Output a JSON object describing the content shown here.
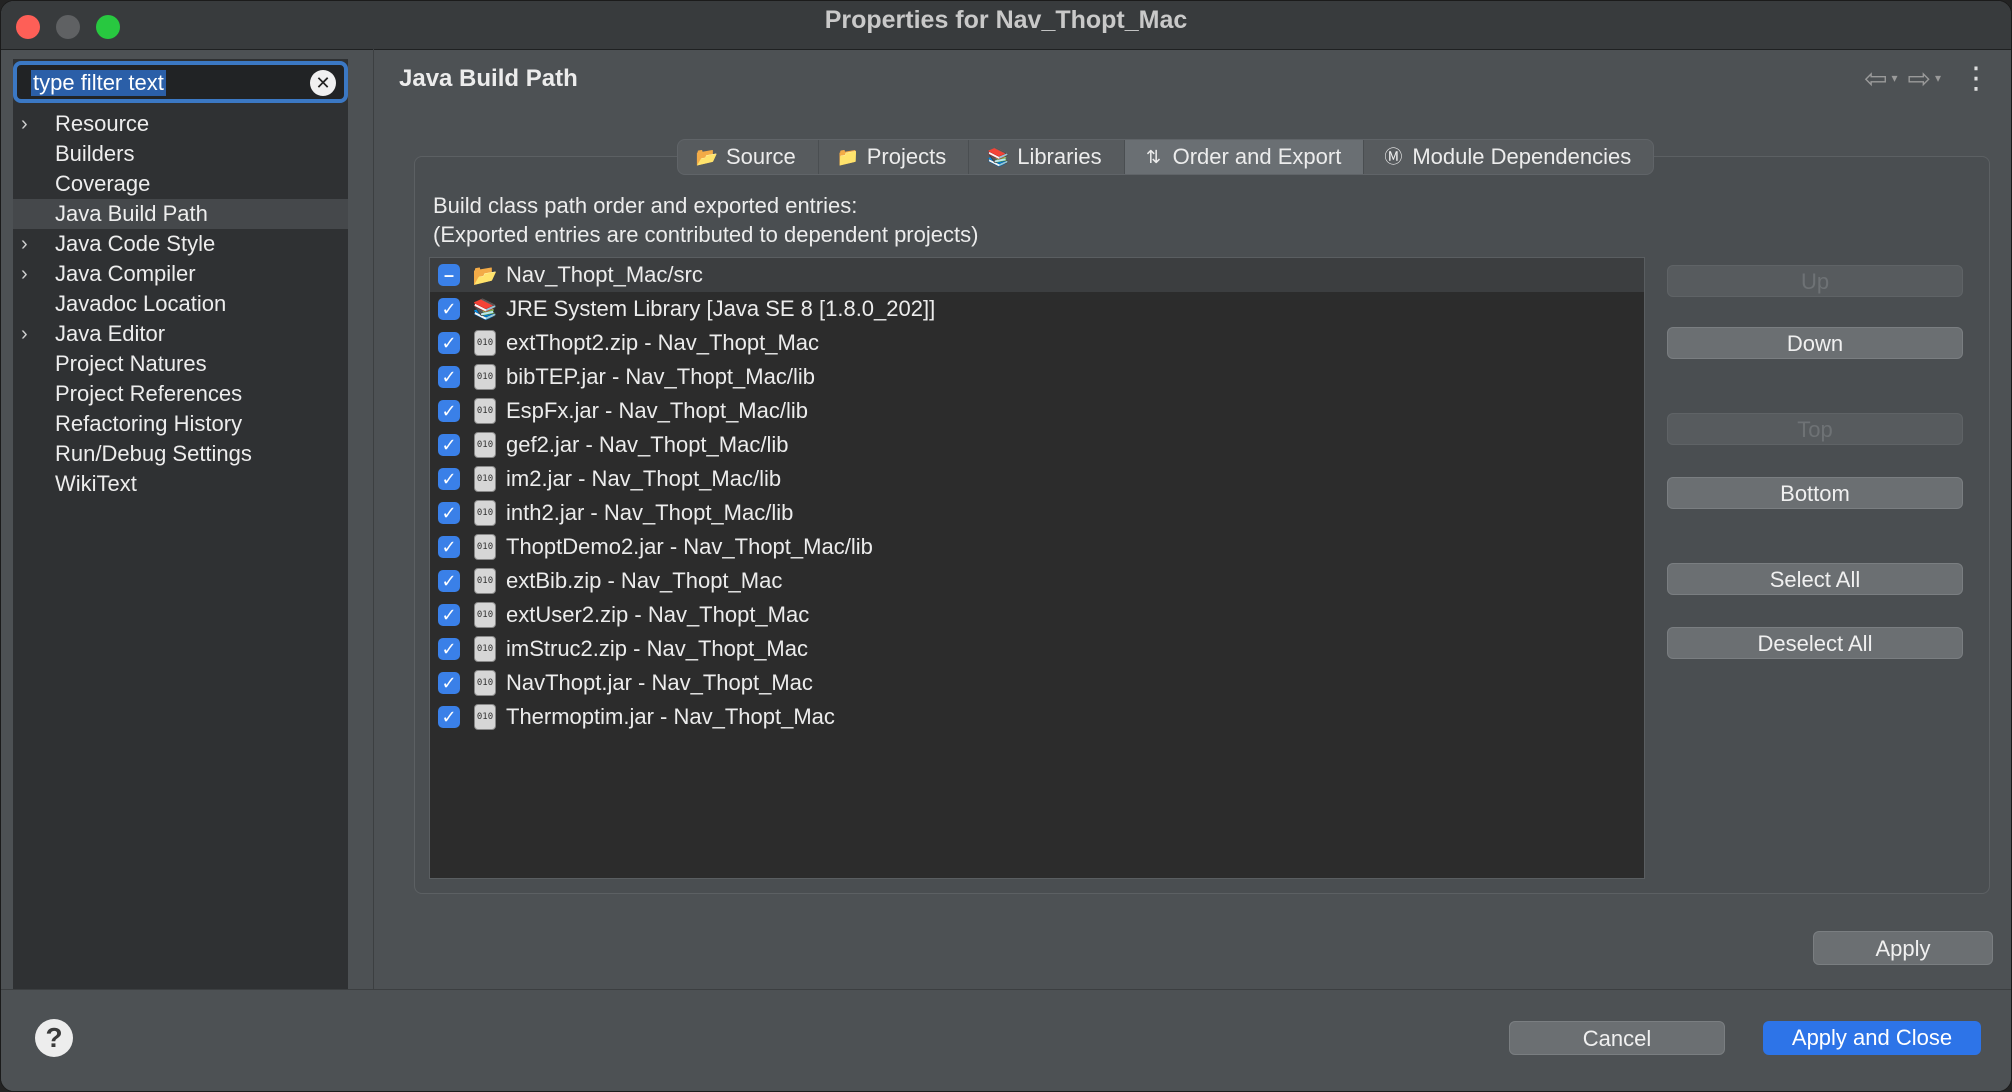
{
  "window": {
    "title": "Properties for Nav_Thopt_Mac"
  },
  "filter": {
    "text": "type filter text"
  },
  "tree": [
    {
      "label": "Resource",
      "expandable": true
    },
    {
      "label": "Builders",
      "expandable": false
    },
    {
      "label": "Coverage",
      "expandable": false
    },
    {
      "label": "Java Build Path",
      "expandable": false,
      "selected": true
    },
    {
      "label": "Java Code Style",
      "expandable": true
    },
    {
      "label": "Java Compiler",
      "expandable": true
    },
    {
      "label": "Javadoc Location",
      "expandable": false
    },
    {
      "label": "Java Editor",
      "expandable": true
    },
    {
      "label": "Project Natures",
      "expandable": false
    },
    {
      "label": "Project References",
      "expandable": false
    },
    {
      "label": "Refactoring History",
      "expandable": false
    },
    {
      "label": "Run/Debug Settings",
      "expandable": false
    },
    {
      "label": "WikiText",
      "expandable": false
    }
  ],
  "page": {
    "title": "Java Build Path"
  },
  "tabs": [
    {
      "label": "Source",
      "icon": "source-folder-icon"
    },
    {
      "label": "Projects",
      "icon": "projects-folder-icon"
    },
    {
      "label": "Libraries",
      "icon": "libraries-icon"
    },
    {
      "label": "Order and Export",
      "icon": "order-export-icon",
      "active": true
    },
    {
      "label": "Module Dependencies",
      "icon": "module-icon"
    }
  ],
  "description": {
    "line1": "Build class path order and exported entries:",
    "line2": "(Exported entries are contributed to dependent projects)"
  },
  "entries": [
    {
      "label": "Nav_Thopt_Mac/src",
      "state": "indeterminate",
      "icon": "source-folder-icon",
      "selected": true
    },
    {
      "label": "JRE System Library [Java SE 8 [1.8.0_202]]",
      "state": "checked",
      "icon": "library-icon"
    },
    {
      "label": "extThopt2.zip - Nav_Thopt_Mac",
      "state": "checked",
      "icon": "jar-icon"
    },
    {
      "label": "bibTEP.jar - Nav_Thopt_Mac/lib",
      "state": "checked",
      "icon": "jar-icon"
    },
    {
      "label": "EspFx.jar - Nav_Thopt_Mac/lib",
      "state": "checked",
      "icon": "jar-icon"
    },
    {
      "label": "gef2.jar - Nav_Thopt_Mac/lib",
      "state": "checked",
      "icon": "jar-icon"
    },
    {
      "label": "im2.jar - Nav_Thopt_Mac/lib",
      "state": "checked",
      "icon": "jar-icon"
    },
    {
      "label": "inth2.jar - Nav_Thopt_Mac/lib",
      "state": "checked",
      "icon": "jar-icon"
    },
    {
      "label": "ThoptDemo2.jar - Nav_Thopt_Mac/lib",
      "state": "checked",
      "icon": "jar-icon"
    },
    {
      "label": "extBib.zip - Nav_Thopt_Mac",
      "state": "checked",
      "icon": "jar-icon"
    },
    {
      "label": "extUser2.zip - Nav_Thopt_Mac",
      "state": "checked",
      "icon": "jar-icon"
    },
    {
      "label": "imStruc2.zip - Nav_Thopt_Mac",
      "state": "checked",
      "icon": "jar-icon"
    },
    {
      "label": "NavThopt.jar - Nav_Thopt_Mac",
      "state": "checked",
      "icon": "jar-icon"
    },
    {
      "label": "Thermoptim.jar - Nav_Thopt_Mac",
      "state": "checked",
      "icon": "jar-icon"
    }
  ],
  "side_buttons": {
    "up": "Up",
    "down": "Down",
    "top": "Top",
    "bottom": "Bottom",
    "select_all": "Select All",
    "deselect_all": "Deselect All"
  },
  "buttons": {
    "apply": "Apply",
    "cancel": "Cancel",
    "apply_and_close": "Apply and Close",
    "help": "?"
  },
  "colors": {
    "accent": "#2d74e8",
    "checkbox": "#3a80e8",
    "filter_border": "#3b78c4"
  }
}
